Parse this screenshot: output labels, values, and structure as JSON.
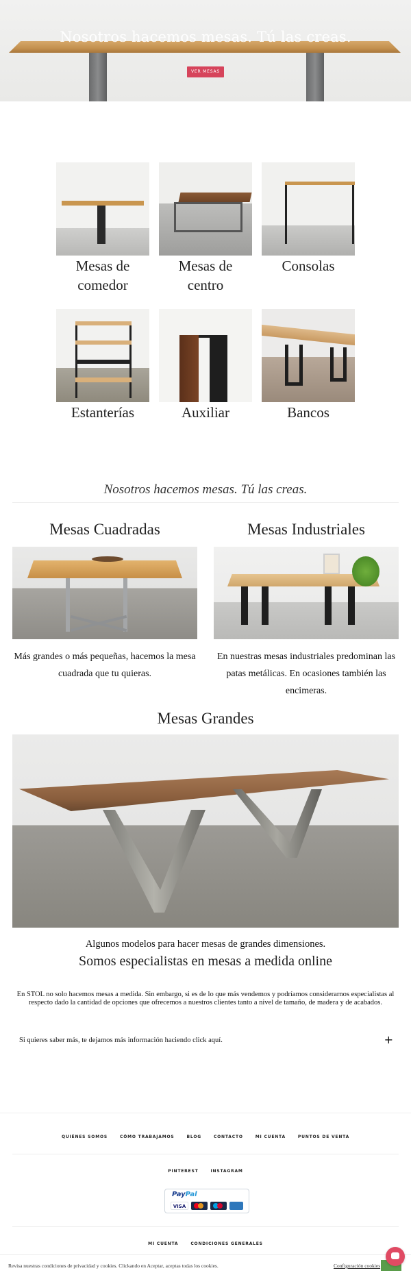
{
  "hero": {
    "title": "Nosotros hacemos mesas. Tú las creas.",
    "button": "VER MESAS"
  },
  "categories": [
    {
      "label_line1": "Mesas de",
      "label_line2": "comedor"
    },
    {
      "label_line1": "Mesas de",
      "label_line2": "centro"
    },
    {
      "label_line1": "Consolas",
      "label_line2": ""
    },
    {
      "label_line1": "Estanterías",
      "label_line2": ""
    },
    {
      "label_line1": "Auxiliar",
      "label_line2": ""
    },
    {
      "label_line1": "Bancos",
      "label_line2": ""
    }
  ],
  "tagline": "Nosotros hacemos mesas. Tú las creas.",
  "square": {
    "title": "Mesas Cuadradas",
    "text": "Más grandes o más pequeñas, hacemos la mesa cuadrada que tu quieras."
  },
  "industrial": {
    "title": "Mesas Industriales",
    "text": "En nuestras mesas industriales predominan las patas metálicas. En ocasiones también las encimeras."
  },
  "large": {
    "title": "Mesas Grandes",
    "caption": "Algunos modelos para hacer mesas de grandes dimensiones."
  },
  "specialists": {
    "title": "Somos especialistas en mesas a medida online",
    "text": "En STOL  no solo hacemos mesas a medida. Sin embargo, si es de lo que más vendemos y podríamos considerarnos especialistas al respecto dado la cantidad de opciones que ofrecemos a nuestros clientes tanto a nivel de tamaño, de madera y de acabados."
  },
  "accordion": {
    "label": "Si quieres saber más, te dejamos más información haciendo click aquí.",
    "toggle": "+"
  },
  "footer": {
    "nav": [
      "QUIÉNES SOMOS",
      "CÓMO TRABAJAMOS",
      "BLOG",
      "CONTACTO",
      "MI CUENTA",
      "PUNTOS DE VENTA"
    ],
    "social": [
      "PINTEREST",
      "INSTAGRAM"
    ],
    "paypal": {
      "word1": "Pay",
      "word2": "Pal",
      "cards": [
        "VISA",
        "",
        "",
        ""
      ]
    },
    "bottom_nav": [
      "MI CUENTA",
      "CONDICIONES GENERALES"
    ]
  },
  "cookie": {
    "text": "Revisa nuestras condiciones de privacidad y cookies. Clickando en Aceptar, aceptas todas los cookies.",
    "config_link": "Configuración cookies"
  },
  "colors": {
    "accent": "#d6445b",
    "accept_button": "#5a9c4a",
    "chat": "#e04a63",
    "paypal_blue": "#1b3f8f"
  },
  "icons": [
    "plus-icon",
    "chat-icon",
    "paypal-logo",
    "visa-card-icon",
    "mastercard-icon",
    "maestro-icon",
    "amex-card-icon"
  ]
}
